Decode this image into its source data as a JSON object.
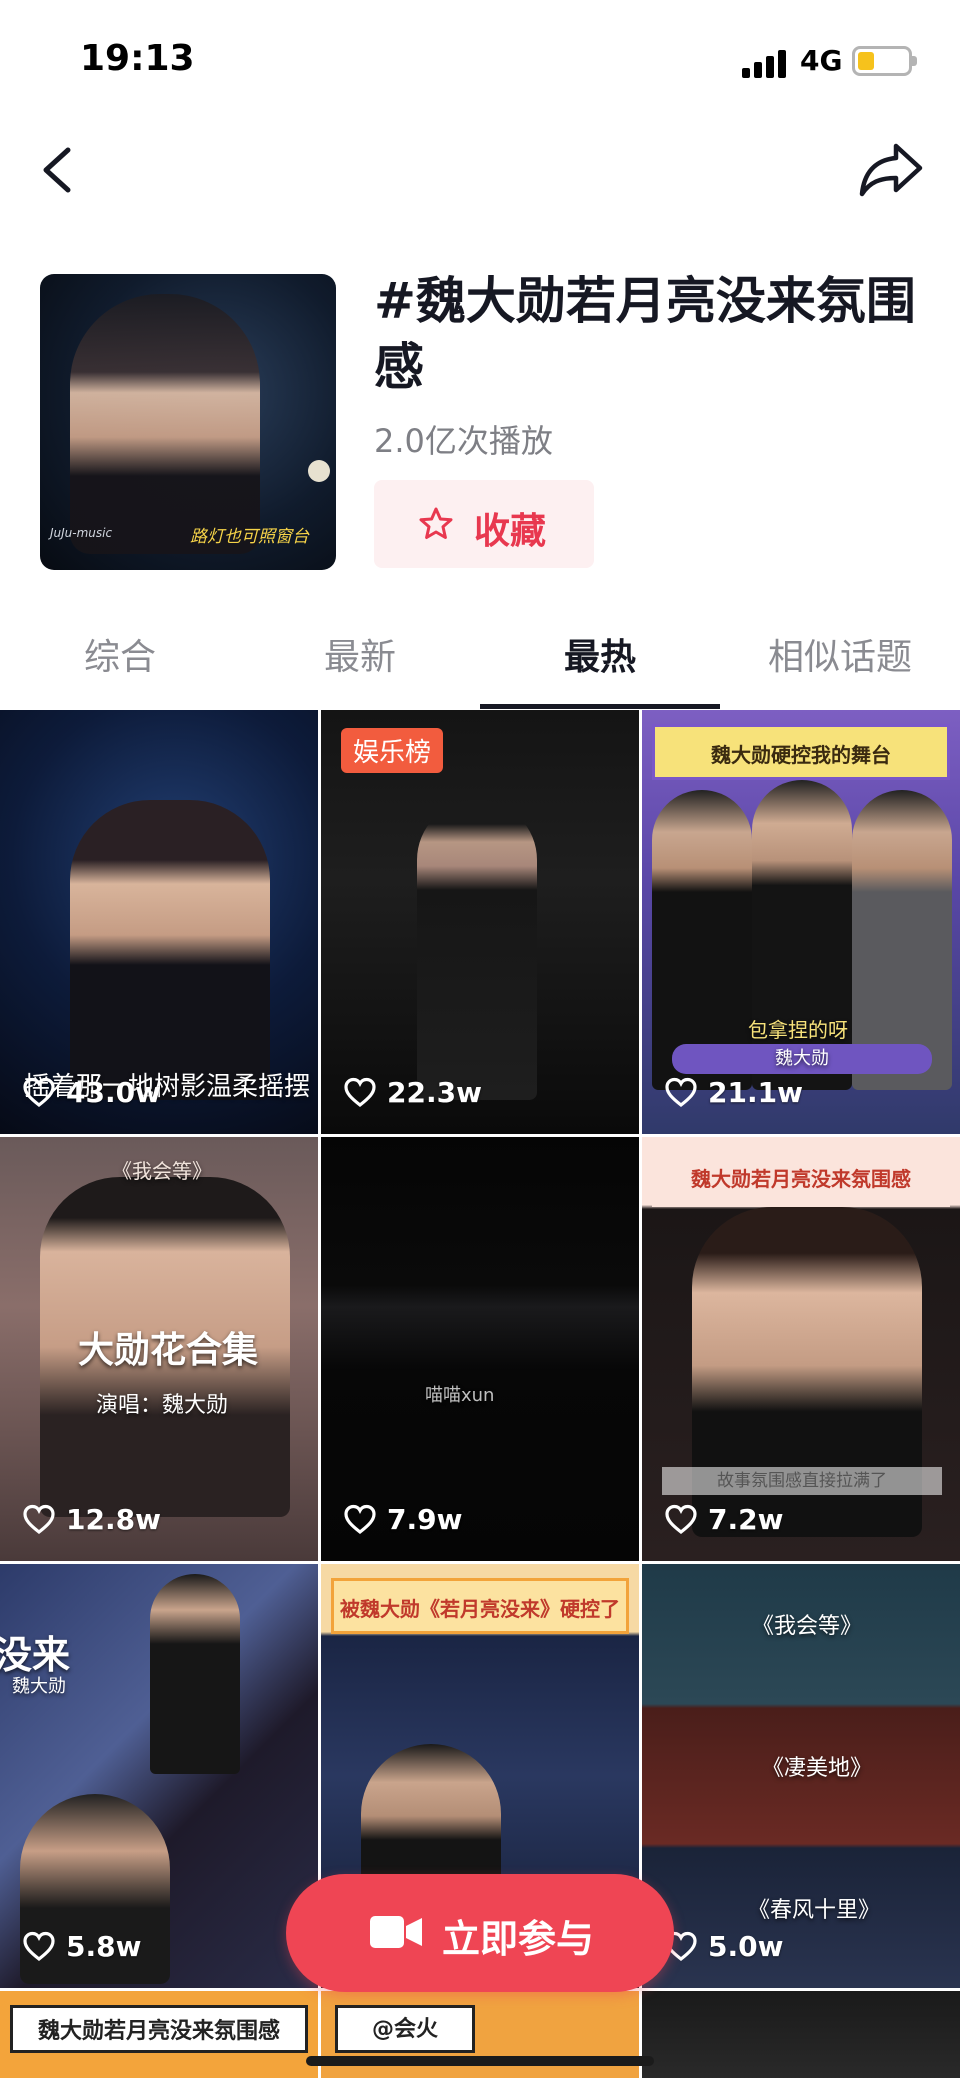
{
  "status_bar": {
    "time": "19:13",
    "network": "4G",
    "battery_color": "#f6c21c"
  },
  "nav": {
    "back_icon": "chevron-left-icon",
    "share_icon": "share-arrow-icon"
  },
  "topic": {
    "title": "#魏大勋若月亮没来氛围感",
    "play_count": "2.0亿次播放",
    "favorite_label": "收藏",
    "cover_caption": "路灯也可照窗台",
    "cover_logo": "JuJu-music"
  },
  "tabs": [
    {
      "label": "综合",
      "active": false
    },
    {
      "label": "最新",
      "active": false
    },
    {
      "label": "最热",
      "active": true
    },
    {
      "label": "相似话题",
      "active": false
    }
  ],
  "videos": [
    {
      "likes": "43.0w",
      "overlay": "摇着那一地树影温柔摇摆"
    },
    {
      "likes": "22.3w",
      "badge": "娱乐榜"
    },
    {
      "likes": "21.1w",
      "banner": "魏大勋硬控我的舞台",
      "overlay": "包拿捏的呀",
      "overlay2": "魏大勋"
    },
    {
      "likes": "12.8w",
      "overlay": "《我会等》",
      "overlay2": "大勋花合集",
      "overlay3": "演唱：魏大勋"
    },
    {
      "likes": "7.9w",
      "overlay": "喵喵xun"
    },
    {
      "likes": "7.2w",
      "banner": "魏大勋若月亮没来氛围感",
      "overlay": "故事氛围感直接拉满了"
    },
    {
      "likes": "5.8w",
      "overlay": "没来",
      "overlay2": "魏大勋"
    },
    {
      "likes": "",
      "banner": "被魏大勋《若月亮没来》硬控了"
    },
    {
      "likes": "5.0w",
      "overlay": "《我会等》",
      "overlay2": "《凄美地》",
      "overlay3": "《春风十里》"
    },
    {
      "likes": "",
      "banner": "魏大勋若月亮没来氛围感"
    },
    {
      "likes": "",
      "banner": "@会火"
    },
    {
      "likes": ""
    }
  ],
  "join_button": {
    "label": "立即参与",
    "icon": "video-camera-icon",
    "color": "#ef4554"
  },
  "colors": {
    "accent": "#e8384f",
    "favorite_bg": "#fdf0f1",
    "badge": "#f25c3e"
  }
}
